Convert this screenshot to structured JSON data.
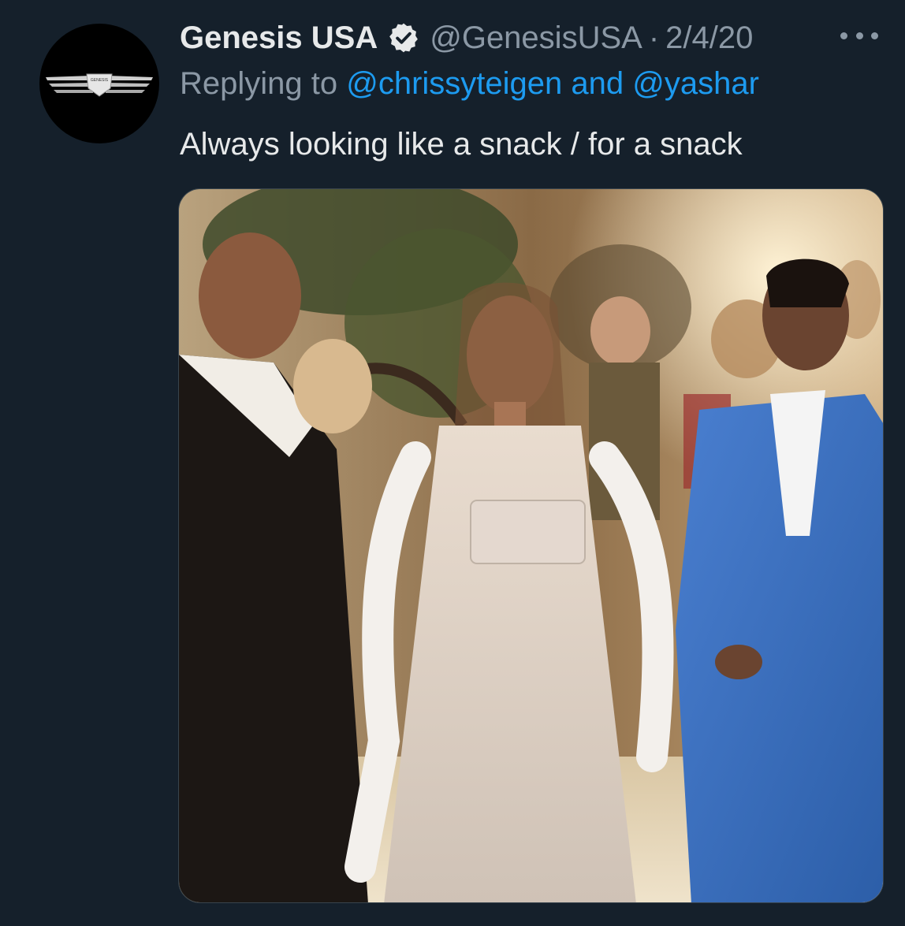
{
  "tweet": {
    "display_name": "Genesis USA",
    "verified_icon": "verified-badge-icon",
    "handle": "@GenesisUSA",
    "separator": "·",
    "date": "2/4/20",
    "more_icon": "more-options-icon",
    "replying_prefix": "Replying to",
    "reply_user_1": "@chrissyteigen",
    "reply_and": "and",
    "reply_user_2": "@yashar",
    "text": "Always looking like a snack / for a snack",
    "avatar": {
      "logo_text": "GENESIS",
      "icon": "genesis-wings-logo"
    },
    "media": {
      "type": "photo",
      "subject": "party scene photo"
    }
  },
  "colors": {
    "background": "#15202b",
    "primary_text": "#e7e9ea",
    "secondary_text": "#8b98a5",
    "link": "#1d9bf0"
  }
}
